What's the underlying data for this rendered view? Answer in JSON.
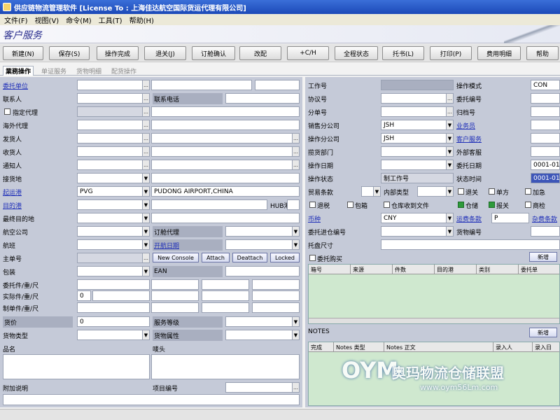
{
  "window": {
    "title": "供应链物流管理软件 [License To : 上海佳达航空国际货运代理有限公司]"
  },
  "menu": {
    "items": [
      "文件(F)",
      "视图(V)",
      "命令(M)",
      "工具(T)",
      "帮助(H)"
    ]
  },
  "page": {
    "title": "客户服务"
  },
  "toolbar": {
    "buttons": [
      "新建(N)",
      "保存(S)",
      "操作完成",
      "退关(J)",
      "订舱确认",
      "改配",
      "+C/H",
      "全程状态",
      "托书(L)",
      "打印(P)",
      "费用明细",
      "帮助"
    ]
  },
  "tabs": [
    "業務操作",
    "单证服务",
    "货物明细",
    "配货操作"
  ],
  "left": {
    "labels": {
      "consignor": "委托单位",
      "contact": "联系人",
      "designated_agent": "指定代理",
      "overseas_agent": "海外代理",
      "shipper": "发货人",
      "consignee": "收货人",
      "notify": "通知人",
      "place_receipt": "接货地",
      "pol": "起运港",
      "pod": "目的港",
      "final_dest": "最终目的地",
      "airline": "航空公司",
      "flight": "航班",
      "master_no": "主单号",
      "packing": "包装",
      "pkg_wt_vol_1": "委托件/重/尺",
      "pkg_wt_vol_2": "实际件/重/尺",
      "pkg_wt_vol_3": "制单件/重/尺",
      "price": "货价",
      "cargo_type": "货物类型",
      "goods_name": "品名",
      "remarks": "附加说明",
      "phone": "联系电话",
      "booking_agent": "订舱代理",
      "flight_date": "开航日期",
      "ean": "EAN",
      "service_level": "服务等级",
      "cargo_attr": "货物属性",
      "marks": "唛头",
      "item_no": "项目编号",
      "hub": "HUB港"
    },
    "values": {
      "pol_code": "PVG",
      "pol_name": "PUDONG AIRPORT,CHINA",
      "actual_pkg": "0",
      "price": "0"
    },
    "buttons": {
      "new_console": "New Console",
      "attach": "Attach",
      "deattach": "Deattach",
      "locked": "Locked"
    }
  },
  "right": {
    "labels": {
      "work_no": "工作号",
      "agreement_no": "协议号",
      "sub_no": "分单号",
      "sales_branch": "销售分公司",
      "op_branch": "操作分公司",
      "hq_dept": "揽货部门",
      "op_date": "操作日期",
      "op_status": "操作状态",
      "trade_terms": "贸易条款",
      "currency": "币种",
      "entrust_wh_no": "委托进仓编号",
      "pallet_size": "托盘尺寸",
      "op_mode": "操作模式",
      "entrust_no": "委托编号",
      "archive_no": "归档号",
      "salesperson": "业务员",
      "cs": "客户服务",
      "ext_cs": "外部客服",
      "entrust_date": "委托日期",
      "status_time": "状态时间",
      "inner_type": "内部类型",
      "settle_terms": "运费条款",
      "cargo_no": "货物编号",
      "insurance": "委托购买",
      "notes": "NOTES"
    },
    "values": {
      "op_mode": "CON",
      "sales_branch": "JSH",
      "op_branch": "JSH",
      "work_no_hint": "制工作号",
      "currency": "CNY",
      "settle_terms": "P",
      "entrust_date": "0001-01-0",
      "status_time": "0001-01-0"
    },
    "checks": {
      "return": "退关",
      "single": "单方",
      "add_chg": "加急",
      "tax": "退税",
      "packing": "包箱",
      "warehouse_receipt": "仓库收到文件",
      "warehouse": "仓储",
      "declare": "报关",
      "inspect": "商检"
    },
    "buttons": {
      "add1": "新增",
      "add2": "新增",
      "collect_terms": "杂费条款"
    },
    "grid1": {
      "columns": [
        "箱号",
        "来源",
        "件数",
        "目的港",
        "类别",
        "委托单"
      ]
    },
    "grid2": {
      "columns": [
        "完成",
        "Notes 类型",
        "Notes 正文",
        "录入人",
        "录入日"
      ]
    }
  },
  "watermark": {
    "logo": "OYM",
    "text": "奥玛物流仓储联盟",
    "url": "www.oym56Lm.com"
  },
  "colors": {
    "title_bar": "#1c49b8",
    "panel": "#c5cad8",
    "link": "#1f2fb8",
    "grid": "#cfe8cf"
  }
}
